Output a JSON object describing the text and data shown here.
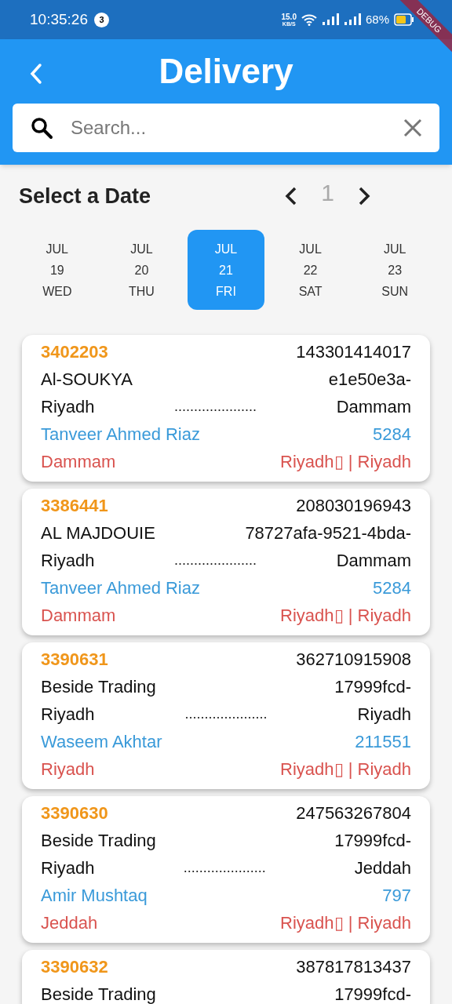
{
  "status_bar": {
    "time": "10:35:26",
    "notification_count": "3",
    "speed": "15.0",
    "speed_unit": "KB/S",
    "battery": "68%"
  },
  "debug_banner": "DEBUG",
  "header": {
    "title": "Delivery"
  },
  "search": {
    "placeholder": "Search..."
  },
  "date_picker": {
    "title": "Select a Date",
    "page": "1",
    "days": [
      {
        "month": "JUL",
        "day": "19",
        "weekday": "WED",
        "selected": false
      },
      {
        "month": "JUL",
        "day": "20",
        "weekday": "THU",
        "selected": false
      },
      {
        "month": "JUL",
        "day": "21",
        "weekday": "FRI",
        "selected": true
      },
      {
        "month": "JUL",
        "day": "22",
        "weekday": "SAT",
        "selected": false
      },
      {
        "month": "JUL",
        "day": "23",
        "weekday": "SUN",
        "selected": false
      }
    ]
  },
  "orders": [
    {
      "order_no": "3402203",
      "reference": "143301414017",
      "customer": "Al-SOUKYA",
      "code": "e1e50e3a-",
      "origin": "Riyadh",
      "leader": ".....................",
      "destination": "Dammam",
      "driver": "Tanveer Ahmed Riaz",
      "driver_id": "5284",
      "city": "Dammam",
      "route": "Riyadh▯ | Riyadh"
    },
    {
      "order_no": "3386441",
      "reference": "208030196943",
      "customer": "AL MAJDOUIE",
      "code": "78727afa-9521-4bda-",
      "origin": "Riyadh",
      "leader": ".....................",
      "destination": "Dammam",
      "driver": "Tanveer Ahmed Riaz",
      "driver_id": "5284",
      "city": "Dammam",
      "route": "Riyadh▯ | Riyadh"
    },
    {
      "order_no": "3390631",
      "reference": "362710915908",
      "customer": "Beside Trading",
      "code": "17999fcd-",
      "origin": "Riyadh",
      "leader": ".....................",
      "destination": "Riyadh",
      "driver": "Waseem Akhtar",
      "driver_id": "211551",
      "city": "Riyadh",
      "route": "Riyadh▯ | Riyadh"
    },
    {
      "order_no": "3390630",
      "reference": "247563267804",
      "customer": "Beside Trading",
      "code": "17999fcd-",
      "origin": "Riyadh",
      "leader": ".....................",
      "destination": "Jeddah",
      "driver": "Amir Mushtaq",
      "driver_id": "797",
      "city": "Jeddah",
      "route": "Riyadh▯ | Riyadh"
    },
    {
      "order_no": "3390632",
      "reference": "387817813437",
      "customer": "Beside Trading",
      "code": "17999fcd-"
    }
  ]
}
